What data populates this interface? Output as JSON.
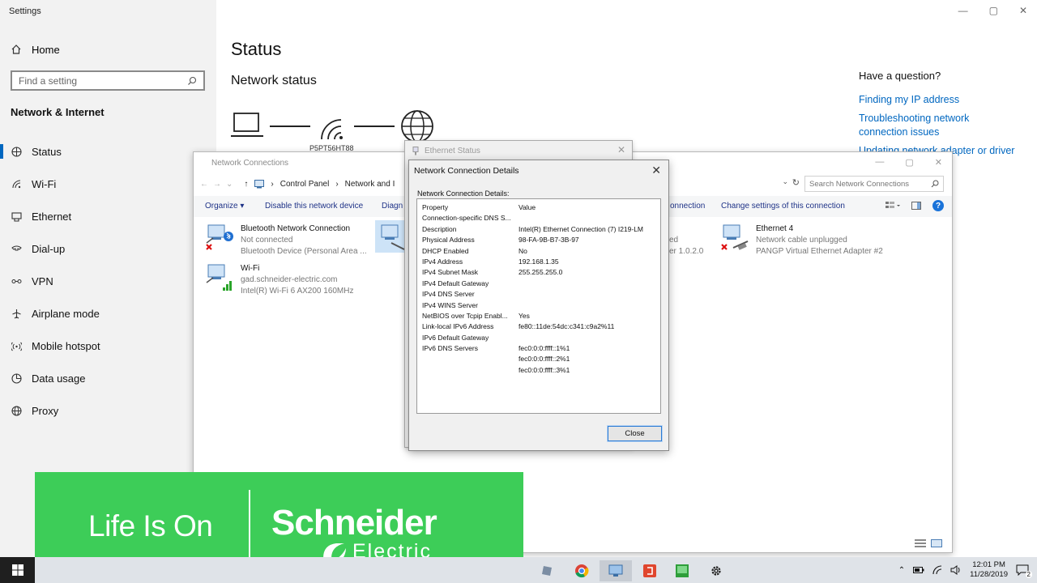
{
  "settings": {
    "window_title": "Settings",
    "home_label": "Home",
    "search_placeholder": "Find a setting",
    "section_heading": "Network & Internet",
    "nav": [
      {
        "label": "Status",
        "icon": "status-icon",
        "selected": true
      },
      {
        "label": "Wi-Fi",
        "icon": "wifi-icon"
      },
      {
        "label": "Ethernet",
        "icon": "ethernet-icon"
      },
      {
        "label": "Dial-up",
        "icon": "dial-up-icon"
      },
      {
        "label": "VPN",
        "icon": "vpn-icon"
      },
      {
        "label": "Airplane mode",
        "icon": "airplane-icon"
      },
      {
        "label": "Mobile hotspot",
        "icon": "hotspot-icon"
      },
      {
        "label": "Data usage",
        "icon": "data-usage-icon"
      },
      {
        "label": "Proxy",
        "icon": "proxy-icon"
      }
    ],
    "page_title": "Status",
    "network_status_heading": "Network status",
    "network_name": "P5PT56HT88",
    "help": {
      "heading": "Have a question?",
      "links": [
        "Finding my IP address",
        "Troubleshooting network connection issues",
        "Updating network adapter or driver"
      ]
    }
  },
  "network_connections": {
    "title": "Network Connections",
    "breadcrumb": [
      "Control Panel",
      "Network and I"
    ],
    "search_placeholder": "Search Network Connections",
    "toolbar": {
      "organize": "Organize ▾",
      "disable": "Disable this network device",
      "diagnose": "Diagn",
      "connection_partial": "onnection",
      "change_settings": "Change settings of this connection"
    },
    "adapters": [
      {
        "name": "Bluetooth Network Connection",
        "status": "Not connected",
        "device": "Bluetooth Device (Personal Area ..."
      },
      {
        "name": "Wi-Fi",
        "status": "gad.schneider-electric.com",
        "device": "Intel(R) Wi-Fi 6 AX200 160MHz"
      },
      {
        "name": "Ethernet 4",
        "status": "Network cable unplugged",
        "device": "PANGP Virtual Ethernet Adapter #2"
      }
    ],
    "partial_texts": [
      "ed",
      "er 1.0.2.0"
    ]
  },
  "ethernet_status": {
    "title": "Ethernet Status"
  },
  "details_dialog": {
    "title": "Network Connection Details",
    "label": "Network Connection Details:",
    "columns": [
      "Property",
      "Value"
    ],
    "rows": [
      [
        "Connection-specific DNS S...",
        ""
      ],
      [
        "Description",
        "Intel(R) Ethernet Connection (7) I219-LM"
      ],
      [
        "Physical Address",
        "98-FA-9B-B7-3B-97"
      ],
      [
        "DHCP Enabled",
        "No"
      ],
      [
        "IPv4 Address",
        "192.168.1.35"
      ],
      [
        "IPv4 Subnet Mask",
        "255.255.255.0"
      ],
      [
        "IPv4 Default Gateway",
        ""
      ],
      [
        "IPv4 DNS Server",
        ""
      ],
      [
        "IPv4 WINS Server",
        ""
      ],
      [
        "NetBIOS over Tcpip Enabl...",
        "Yes"
      ],
      [
        "Link-local IPv6 Address",
        "fe80::11de:54dc:c341:c9a2%11"
      ],
      [
        "IPv6 Default Gateway",
        ""
      ],
      [
        "IPv6 DNS Servers",
        "fec0:0:0:ffff::1%1"
      ],
      [
        "",
        "fec0:0:0:ffff::2%1"
      ],
      [
        "",
        "fec0:0:0:ffff::3%1"
      ]
    ],
    "close_label": "Close"
  },
  "banner": {
    "tagline": "Life Is On",
    "brand_line1": "Schneider",
    "brand_line2": "Electric",
    "color": "#3dcd58"
  },
  "taskbar": {
    "time": "12:01 PM",
    "date": "11/28/2019",
    "notification_count": "2"
  }
}
